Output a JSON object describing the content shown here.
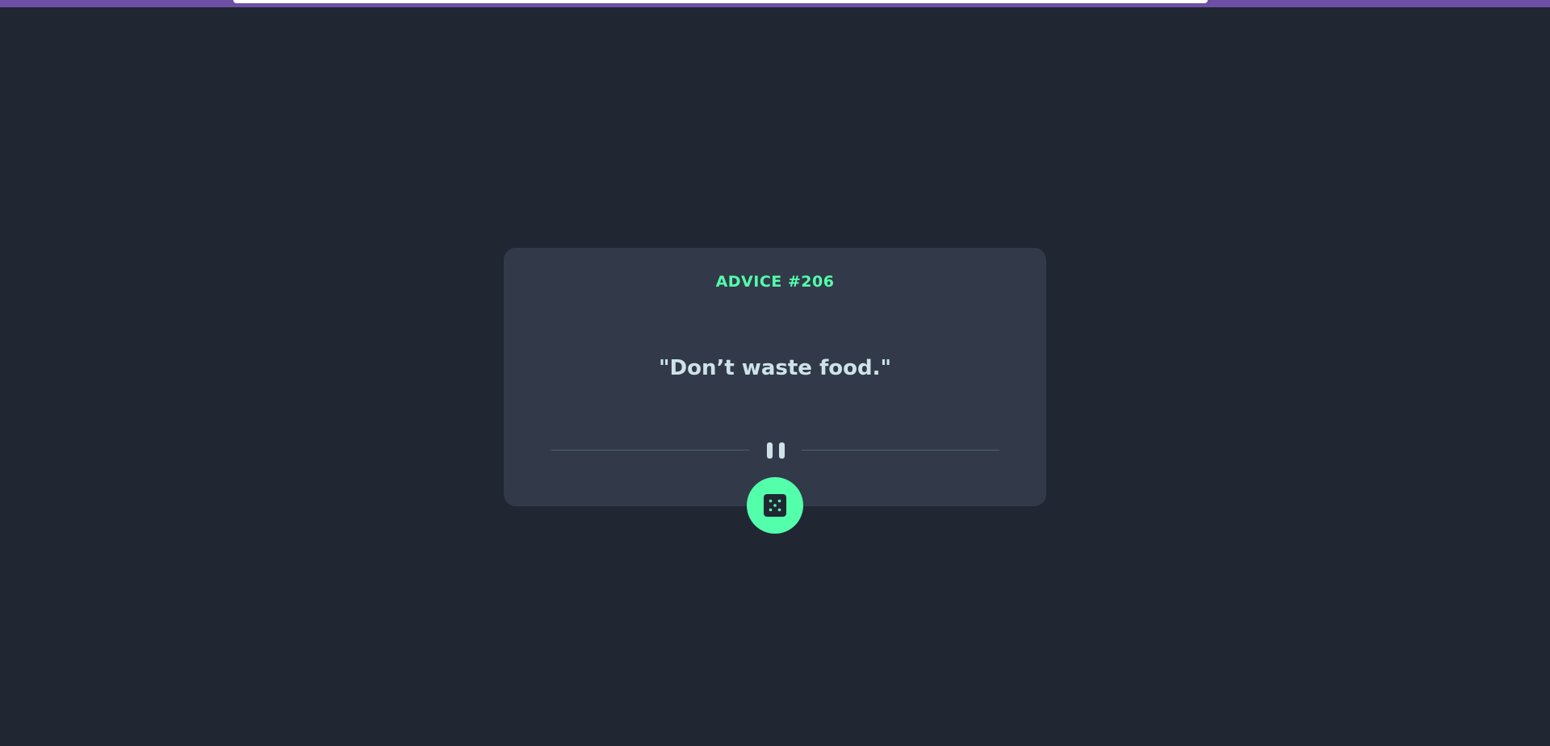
{
  "advice": {
    "id_label": "ADVICE #206",
    "text": "\"Don’t waste food.\""
  },
  "icons": {
    "divider": "pause-icon",
    "button": "dice-icon"
  },
  "colors": {
    "background": "#202733",
    "card": "#323a49",
    "accent": "#53ffaa",
    "text": "#cee3e9",
    "top_bar": "#6f4fa6"
  }
}
